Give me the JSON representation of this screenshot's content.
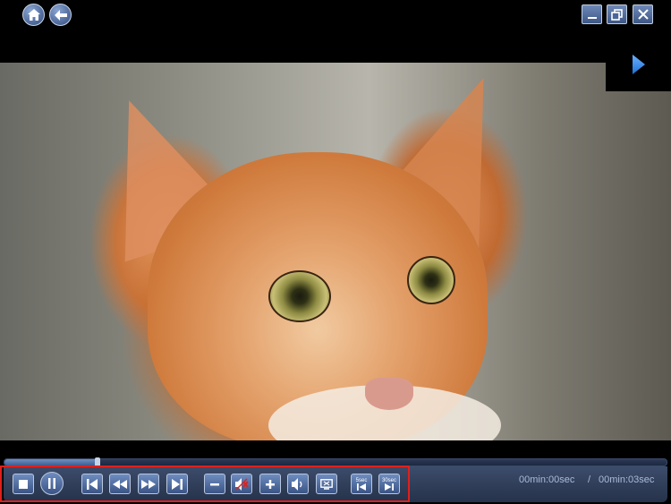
{
  "window": {
    "nav": {
      "home_icon": "home-icon",
      "back_icon": "back-arrow-icon"
    },
    "buttons": {
      "minimize_icon": "minimize-icon",
      "restore_icon": "restore-icon",
      "close_icon": "close-icon"
    }
  },
  "video": {
    "playlist_toggle_icon": "play-arrow-icon"
  },
  "playback": {
    "progress_fraction": 0.14,
    "current_time": "00min:00sec",
    "separator": "/",
    "total_time": "00min:03sec",
    "skip_back_label": "5sec",
    "skip_forward_label": "30sec"
  },
  "colors": {
    "accent": "#4a6699",
    "highlight": "#e0201c",
    "time_text": "#a9bbd8"
  }
}
